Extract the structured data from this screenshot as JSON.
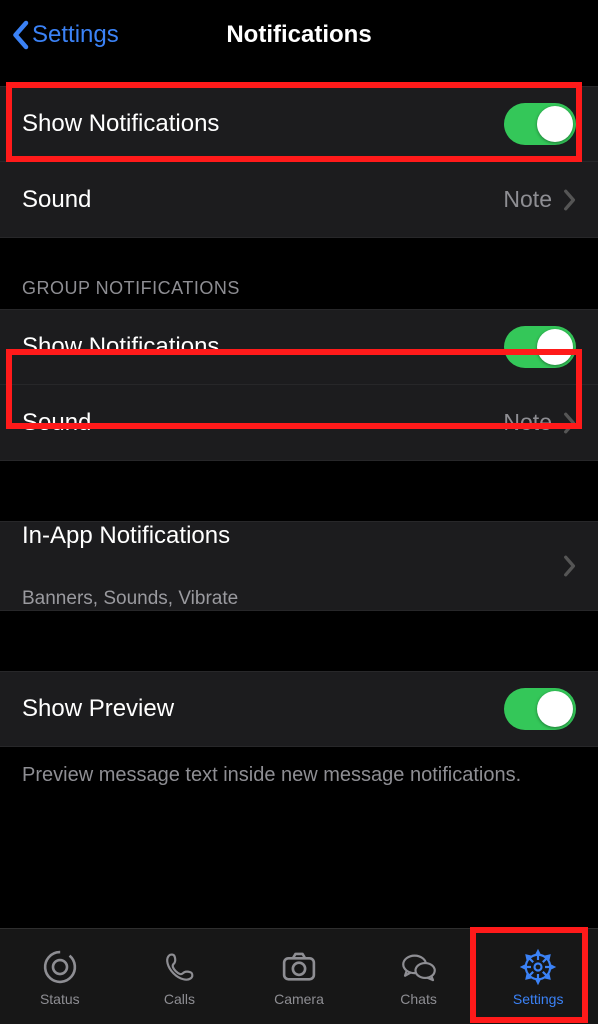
{
  "nav": {
    "back_label": "Settings",
    "title": "Notifications"
  },
  "messages": {
    "show_label": "Show Notifications",
    "sound_label": "Sound",
    "sound_value": "Note"
  },
  "group": {
    "header": "GROUP NOTIFICATIONS",
    "show_label": "Show Notifications",
    "sound_label": "Sound",
    "sound_value": "Note"
  },
  "inapp": {
    "label": "In-App Notifications",
    "sub": "Banners, Sounds, Vibrate"
  },
  "preview": {
    "label": "Show Preview",
    "footer": "Preview message text inside new message notifications."
  },
  "tabs": {
    "status": "Status",
    "calls": "Calls",
    "camera": "Camera",
    "chats": "Chats",
    "settings": "Settings"
  }
}
